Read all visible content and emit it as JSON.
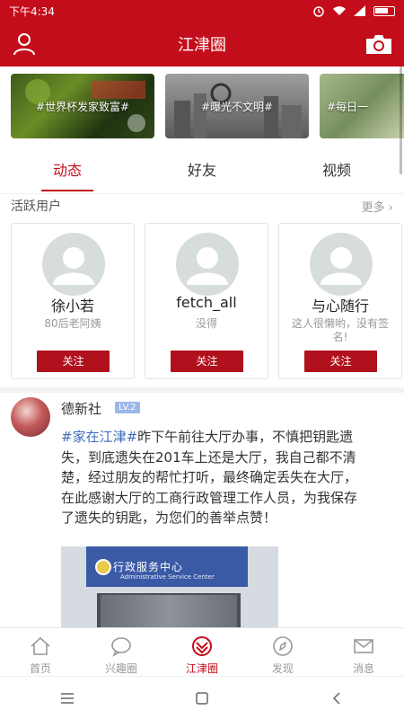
{
  "status_bar": {
    "time": "下午4:34"
  },
  "header": {
    "title": "江津圈"
  },
  "banners": [
    {
      "label": "#世界杯发家致富#"
    },
    {
      "label": "#曝光不文明#"
    },
    {
      "label": "#每日一"
    }
  ],
  "tabs": [
    {
      "label": "动态",
      "active": true
    },
    {
      "label": "好友",
      "active": false
    },
    {
      "label": "视频",
      "active": false
    }
  ],
  "active_users": {
    "title": "活跃用户",
    "more": "更多",
    "users": [
      {
        "name": "徐小若",
        "desc": "80后老阿姨",
        "follow": "关注"
      },
      {
        "name": "fetch_all",
        "desc": "没得",
        "follow": "关注"
      },
      {
        "name": "与心随行",
        "desc": "这人很懒哟，没有签名!",
        "follow": "关注"
      }
    ]
  },
  "post": {
    "author": "德新社",
    "level": "LV.2",
    "hashtag": "#家在江津#",
    "text": "昨下午前往大厅办事，不慎把钥匙遗失，到底遗失在201车上还是大厅，我自己都不清楚，经过朋友的帮忙打听，最终确定丢失在大厅，在此感谢大厅的工商行政管理工作人员，为我保存了遗失的钥匙，为您们的善举点赞！",
    "image": {
      "sign_main": "行政服务中心",
      "sign_sub": "Administrative Service Center"
    }
  },
  "bottom_nav": [
    {
      "label": "首页",
      "icon": "home-icon",
      "active": false
    },
    {
      "label": "兴趣圈",
      "icon": "chat-bubble-icon",
      "active": false
    },
    {
      "label": "江津圈",
      "icon": "circle-logo-icon",
      "active": true
    },
    {
      "label": "发现",
      "icon": "compass-icon",
      "active": false
    },
    {
      "label": "消息",
      "icon": "mail-icon",
      "active": false
    }
  ],
  "colors": {
    "brand": "#c40d1a",
    "hashtag": "#3d6cb9",
    "level_badge": "#9bb7e8"
  }
}
